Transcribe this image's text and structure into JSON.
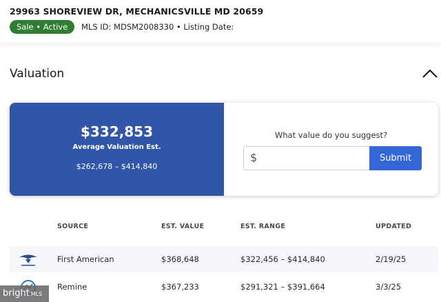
{
  "listing": {
    "address": "29963 SHOREVIEW DR, MECHANICSVILLE MD 20659",
    "status_badge": "Sale • Active",
    "mls_line": "MLS ID: MDSM2008330 • Listing Date:"
  },
  "valuation": {
    "title": "Valuation",
    "average_value": "$332,853",
    "average_label": "Average Valuation Est.",
    "range": "$262,678 – $414,840",
    "suggest_question": "What value do you suggest?",
    "currency_prefix": "$",
    "suggest_input_value": "",
    "submit_label": "Submit",
    "accent_color": "#3155a8",
    "button_color": "#3367d6"
  },
  "table": {
    "headers": [
      "SOURCE",
      "EST. VALUE",
      "EST. RANGE",
      "UPDATED"
    ],
    "rows": [
      {
        "icon": "eagle-logo-icon",
        "source": "First American",
        "value": "$368,648",
        "range": "$322,456 – $414,840",
        "updated": "2/19/25"
      },
      {
        "icon": "remine-logo-icon",
        "source": "Remine",
        "value": "$367,233",
        "range": "$291,321 – $391,664",
        "updated": "3/3/25"
      }
    ]
  },
  "watermark": {
    "brand": "bright",
    "suffix": "MLS"
  },
  "colors": {
    "status_active": "#2e7d32"
  }
}
